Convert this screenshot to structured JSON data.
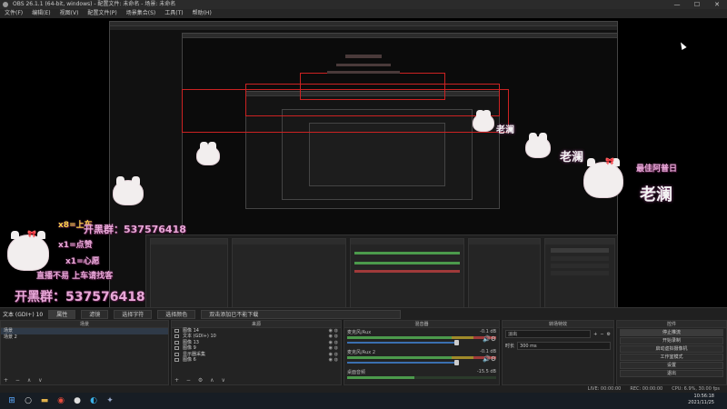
{
  "window": {
    "title": "OBS 26.1.1 (64-bit, windows) - 配置文件: 未命名 - 场景: 未命名",
    "controls": [
      "—",
      "☐",
      "✕"
    ]
  },
  "menu": [
    "文件(F)",
    "编辑(E)",
    "视图(V)",
    "配置文件(P)",
    "场景集合(S)",
    "工具(T)",
    "帮助(H)"
  ],
  "overlay": {
    "lines_left": [
      "x8=上车",
      "x1=点赞",
      "x1=心愿"
    ],
    "group_text": "开黑群：537576418",
    "help_text": "直播不易 上车请找客",
    "name": "老澜",
    "tag": "最佳阿普日"
  },
  "status_row": {
    "scene_label": "文本 (GDI+) 10",
    "buttons": [
      "属性",
      "滤镜",
      "选择字符",
      "选择颜色"
    ],
    "text_value": "双击添加已不能下载"
  },
  "docks": {
    "scenes": {
      "title": "场景",
      "items": [
        "场景",
        "场景 2"
      ]
    },
    "sources": {
      "title": "来源",
      "items": [
        "图像 14",
        "文本 (GDI+) 10",
        "图像 13",
        "图像 9",
        "显示器采集",
        "图像 6"
      ]
    },
    "mixer": {
      "title": "混音器",
      "tracks": [
        {
          "name": "麦克风/Aux",
          "db": "-0.1 dB"
        },
        {
          "name": "麦克风/Aux 2",
          "db": "-0.1 dB"
        },
        {
          "name": "桌面音频",
          "db": "-15.5 dB"
        }
      ]
    },
    "transitions": {
      "title": "转场特效",
      "type": "淡出",
      "duration_label": "时长",
      "duration_value": "300 ms"
    },
    "controls": {
      "title": "控件",
      "buttons": [
        "停止推流",
        "开始录制",
        "启动虚拟摄像机",
        "工作室模式",
        "设置",
        "退出"
      ]
    }
  },
  "obs_status": {
    "live": "LIVE: 00:00:00",
    "rec": "REC: 00:00:00",
    "cpu": "CPU: 6.9%, 30.00 fps"
  },
  "taskbar": {
    "time": "10:56:18",
    "date": "2021/11/25"
  }
}
